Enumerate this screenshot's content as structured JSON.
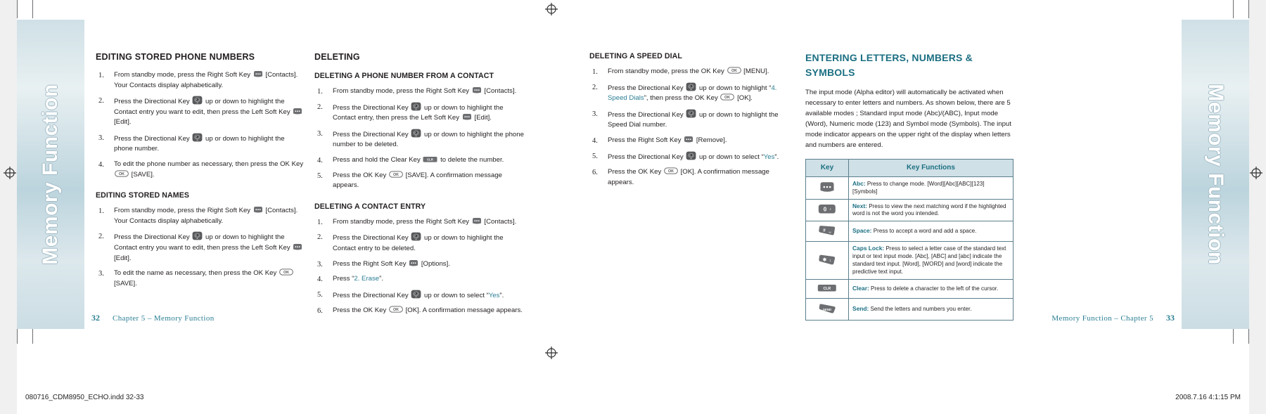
{
  "band": {
    "left_text": "Memory Function",
    "right_text": "Memory Function"
  },
  "col1": {
    "h_editing_numbers": "EDITING STORED PHONE NUMBERS",
    "steps_numbers": [
      "From standby mode, press the Right Soft Key @SOFT@ [Contacts]. Your Contacts display alphabetically.",
      "Press the Directional Key @DIR@ up or down to highlight the Contact entry you want to edit, then press the Left Soft Key @SOFT@ [Edit].",
      "Press the Directional Key @DIR@ up or down to highlight the phone number.",
      "To edit the phone number as necessary, then press the OK Key @OK@ [SAVE]."
    ],
    "h_editing_names": "EDITING STORED NAMES",
    "steps_names": [
      "From standby mode, press the Right Soft Key @SOFT@ [Contacts]. Your Contacts display alphabetically.",
      "Press the Directional Key @DIR@ up or down to highlight the Contact entry you want to edit, then press the Left Soft Key @SOFT@ [Edit].",
      "To edit the name as necessary, then press the OK Key @OK@ [SAVE]."
    ]
  },
  "col2": {
    "h_deleting": "DELETING",
    "h_phone_from_contact": "DELETING A PHONE NUMBER FROM A CONTACT",
    "steps_phone": [
      "From standby mode, press the Right Soft Key @SOFT@ [Contacts].",
      "Press the Directional Key @DIR@ up or down to highlight the Contact entry, then press the  Left Soft Key @SOFT@ [Edit].",
      "Press the Directional Key @DIR@ up or down to highlight the phone number to be deleted.",
      "Press and hold the Clear Key @CLR@ to delete the number.",
      "Press the OK Key @OK@ [SAVE]. A confirmation message appears."
    ],
    "h_contact_entry": "DELETING A CONTACT ENTRY",
    "steps_contact": [
      "From standby mode, press the Right Soft Key @SOFT@ [Contacts].",
      "Press the Directional Key @DIR@ up or down to highlight the Contact entry to be deleted.",
      "Press the Right Soft Key @SOFT@ [Options].",
      "Press “@T:2. Erase@”.",
      "Press the Directional Key @DIR@ up or down to select “@T:Yes@”.",
      "Press the OK Key @OK@ [OK]. A confirmation message appears."
    ]
  },
  "col3": {
    "h_speed_dial": "DELETING A SPEED DIAL",
    "steps_speed": [
      "From standby mode, press the OK Key @OK@ [MENU].",
      "Press the Directional Key @DIR@ up or down to highlight “@T:4. Speed Dials@”, then press the OK Key @OK@ [OK].",
      "Press the Directional Key @DIR@ up or down to highlight the Speed Dial number.",
      "Press the Right Soft Key @SOFT@ [Remove].",
      "Press the Directional Key @DIR@ up or down to select “@T:Yes@”.",
      "Press the OK Key @OK@ [OK]. A confirmation message appears."
    ]
  },
  "col4": {
    "heading": "ENTERING LETTERS, NUMBERS & SYMBOLS",
    "intro": "The input mode (Alpha editor) will automatically be activated when necessary to enter letters and numbers. As shown below, there are 5 available modes ; Standard input mode (Abc)/(ABC), Input mode (Word), Numeric mode (123) and Symbol mode (Symbols). The input mode indicator appears on the upper right of the display when letters and numbers are entered.",
    "table": {
      "headers": [
        "Key",
        "Key Functions"
      ],
      "rows": [
        {
          "icon": "soft-key-icon",
          "term": "Abc:",
          "text": "Press to change mode. [Word][Abc][ABC][123][Symbols]"
        },
        {
          "icon": "zero-key-icon",
          "term": "Next:",
          "text": "Press to view the next matching word if the highlighted word is not the word you intended."
        },
        {
          "icon": "pound-key-icon",
          "term": "Space:",
          "text": "Press to accept a word and add a space."
        },
        {
          "icon": "star-key-icon",
          "term": "Caps Lock:",
          "text": "Press to select a letter case of the standard text input or text input mode. [Abc], [ABC] and [abc] indicate the standard text input. [Word], [WORD] and [word] indicate the predictive text input."
        },
        {
          "icon": "clear-key-icon",
          "term": "Clear:",
          "text": "Press to delete a character to the left of the cursor."
        },
        {
          "icon": "send-key-icon",
          "term": "Send:",
          "text": "Send the letters and numbers you enter."
        }
      ]
    }
  },
  "footer": {
    "left_page": "32",
    "left_title": "Chapter 5  –  Memory Function",
    "right_title": "Memory Function  –  Chapter 5",
    "right_page": "33",
    "slug_left": "080716_CDM8950_ECHO.indd   32-33",
    "slug_right": "2008.7.16   4:1:15 PM"
  },
  "colors": {
    "teal": "#1b6f82",
    "teal_light": "#2b7f93",
    "band": "#cfe0e6",
    "rule": "#5b7f8c"
  }
}
